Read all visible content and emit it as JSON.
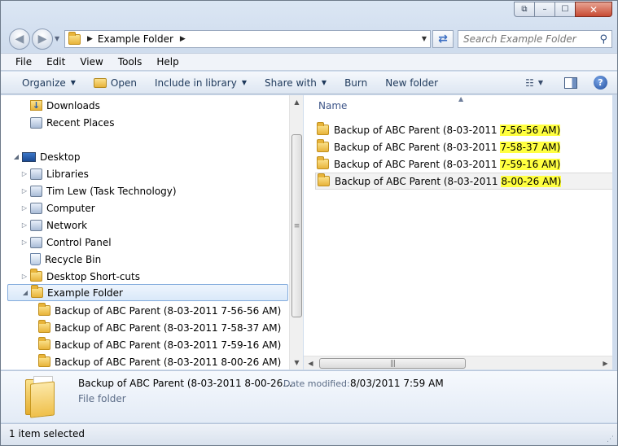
{
  "title_bar": {
    "buttons": [
      {
        "name": "restore-down-button",
        "glyph": "⧉"
      },
      {
        "name": "minimize-button",
        "glyph": "–"
      },
      {
        "name": "maximize-button",
        "glyph": "☐"
      },
      {
        "name": "close-button",
        "glyph": "✕"
      }
    ]
  },
  "address_bar": {
    "path": "Example Folder",
    "search_placeholder": "Search Example Folder"
  },
  "menu": [
    "File",
    "Edit",
    "View",
    "Tools",
    "Help"
  ],
  "commands": {
    "organize": "Organize",
    "open": "Open",
    "include": "Include in library",
    "share": "Share with",
    "burn": "Burn",
    "new_folder": "New folder"
  },
  "nav_tree": [
    {
      "label": "Downloads",
      "icon": "downloads-icon",
      "expander": ""
    },
    {
      "label": "Recent Places",
      "icon": "recent-places-icon",
      "expander": ""
    },
    {
      "label": "Desktop",
      "icon": "desktop-icon",
      "expander": "◢"
    },
    {
      "label": "Libraries",
      "icon": "libraries-icon",
      "expander": "▷"
    },
    {
      "label": "Tim Lew  (Task Technology)",
      "icon": "user-icon",
      "expander": "▷"
    },
    {
      "label": "Computer",
      "icon": "computer-icon",
      "expander": "▷"
    },
    {
      "label": "Network",
      "icon": "network-icon",
      "expander": "▷"
    },
    {
      "label": "Control Panel",
      "icon": "control-panel-icon",
      "expander": "▷"
    },
    {
      "label": "Recycle Bin",
      "icon": "recycle-bin-icon",
      "expander": ""
    },
    {
      "label": "Desktop Short-cuts",
      "icon": "folder-icon",
      "expander": "▷"
    },
    {
      "label": "Example Folder",
      "icon": "folder-icon",
      "expander": "◢",
      "selected": true
    },
    {
      "label": "Backup of ABC Parent (8-03-2011 7-56-56 AM)",
      "icon": "folder-icon",
      "expander": ""
    },
    {
      "label": "Backup of ABC Parent (8-03-2011 7-58-37 AM)",
      "icon": "folder-icon",
      "expander": ""
    },
    {
      "label": "Backup of ABC Parent (8-03-2011 7-59-16 AM)",
      "icon": "folder-icon",
      "expander": ""
    },
    {
      "label": "Backup of ABC Parent (8-03-2011 8-00-26 AM)",
      "icon": "folder-icon",
      "expander": ""
    }
  ],
  "content": {
    "column_name": "Name",
    "files": [
      {
        "prefix": "Backup of ABC Parent (8-03-2011 ",
        "highlight": "7-56-56 AM)"
      },
      {
        "prefix": "Backup of ABC Parent (8-03-2011 ",
        "highlight": "7-58-37 AM)"
      },
      {
        "prefix": "Backup of ABC Parent (8-03-2011 ",
        "highlight": "7-59-16 AM)"
      },
      {
        "prefix": "Backup of ABC Parent (8-03-2011 ",
        "highlight": "8-00-26 AM)",
        "selected": true
      }
    ],
    "highlight_color": "#ffff40"
  },
  "details": {
    "name": "Backup of ABC Parent (8-03-2011 8-00-26...",
    "modified_label": "Date modified:",
    "modified_value": "8/03/2011 7:59 AM",
    "type": "File folder"
  },
  "status": {
    "text": "1 item selected"
  }
}
